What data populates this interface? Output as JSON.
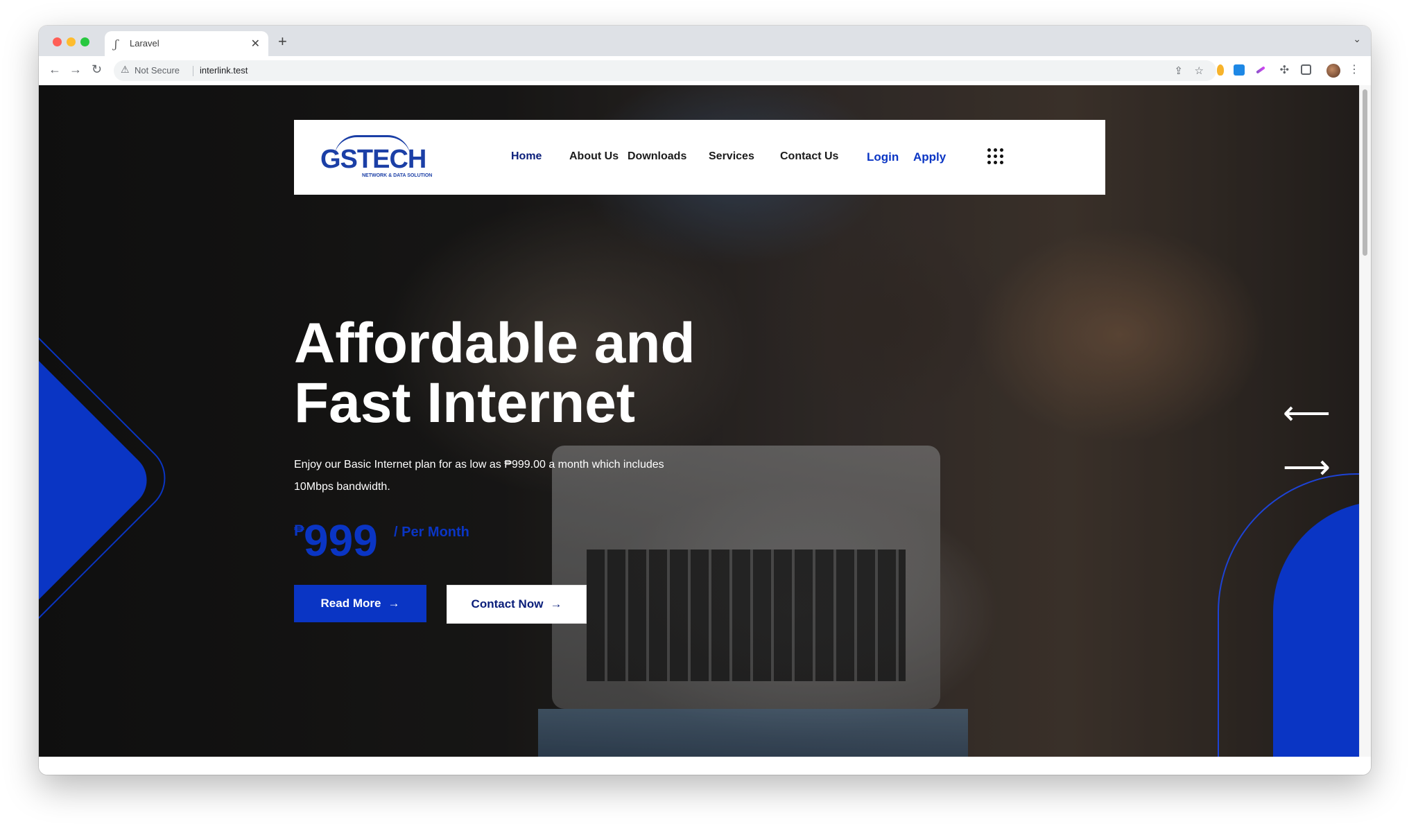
{
  "browser": {
    "tab_title": "Laravel",
    "tab_close": "✕",
    "new_tab": "+",
    "not_secure": "Not Secure",
    "url": "interlink.test"
  },
  "site": {
    "logo_text": "GSTECH",
    "logo_subtitle": "NETWORK & DATA SOLUTION",
    "nav": [
      "Home",
      "About Us",
      "Downloads",
      "Services",
      "Contact Us"
    ],
    "login": "Login",
    "apply": "Apply"
  },
  "hero": {
    "title_line1": "Affordable and",
    "title_line2": "Fast Internet",
    "description_line1": "Enjoy our Basic Internet plan for as low as ₱999.00 a month which includes",
    "description_line2": "10Mbps bandwidth.",
    "currency": "₱",
    "price": "999",
    "per_month": "/ Per Month",
    "read_more": "Read More",
    "contact_now": "Contact Now"
  },
  "colors": {
    "brand_blue": "#0a35c4",
    "nav_active": "#0a1e7a"
  }
}
